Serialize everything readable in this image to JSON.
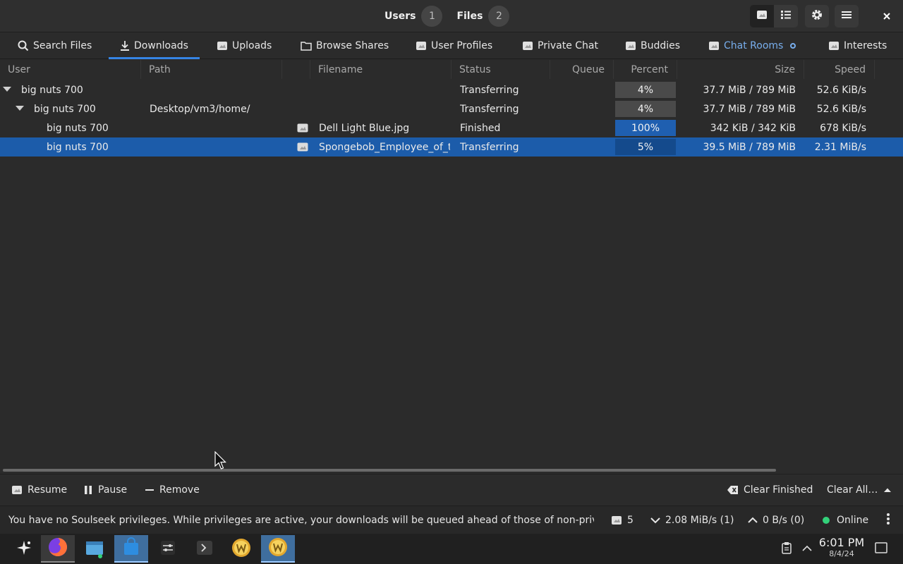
{
  "header": {
    "users_label": "Users",
    "users_count": "1",
    "files_label": "Files",
    "files_count": "2"
  },
  "tabs": [
    {
      "label": "Search Files",
      "icon": "search-icon"
    },
    {
      "label": "Downloads",
      "icon": "download-icon",
      "active": true
    },
    {
      "label": "Uploads",
      "icon": "missing-image-icon"
    },
    {
      "label": "Browse Shares",
      "icon": "folder-icon"
    },
    {
      "label": "User Profiles",
      "icon": "missing-image-icon"
    },
    {
      "label": "Private Chat",
      "icon": "missing-image-icon"
    },
    {
      "label": "Buddies",
      "icon": "missing-image-icon"
    },
    {
      "label": "Chat Rooms",
      "icon": "missing-image-icon",
      "highlight": true
    },
    {
      "label": "Interests",
      "icon": "missing-image-icon"
    }
  ],
  "columns": {
    "user": "User",
    "path": "Path",
    "filename": "Filename",
    "status": "Status",
    "queue": "Queue",
    "percent": "Percent",
    "size": "Size",
    "speed": "Speed"
  },
  "rows": [
    {
      "user": "big nuts 700",
      "path": "",
      "filename": "",
      "status": "Transferring",
      "queue": "",
      "percent": "4%",
      "size": "37.7 MiB / 789 MiB",
      "speed": "52.6 KiB/s"
    },
    {
      "user": "big nuts 700",
      "path": "Desktop/vm3/home/",
      "filename": "",
      "status": "Transferring",
      "queue": "",
      "percent": "4%",
      "size": "37.7 MiB / 789 MiB",
      "speed": "52.6 KiB/s"
    },
    {
      "user": "big nuts 700",
      "path": "",
      "filename": "Dell Light Blue.jpg",
      "status": "Finished",
      "queue": "",
      "percent": "100%",
      "size": "342 KiB / 342 KiB",
      "speed": "678 KiB/s"
    },
    {
      "user": "big nuts 700",
      "path": "",
      "filename": "Spongebob_Employee_of_the",
      "status": "Transferring",
      "queue": "",
      "percent": "5%",
      "size": "39.5 MiB / 789 MiB",
      "speed": "2.31 MiB/s",
      "selected": true
    }
  ],
  "actions": {
    "resume": "Resume",
    "pause": "Pause",
    "remove": "Remove",
    "clear_finished": "Clear Finished",
    "clear_all": "Clear All…"
  },
  "statusbar": {
    "message": "You have no Soulseek privileges. While privileges are active, your downloads will be queued ahead of those of non-privileged …",
    "connections": "5",
    "download_speed": "2.08 MiB/s (1)",
    "upload_speed": "0 B/s (0)",
    "status": "Online"
  },
  "taskbar": {
    "time": "6:01 PM",
    "date": "8/4/24"
  },
  "colors": {
    "accent": "#3584e4",
    "selected_row": "#1c5caa",
    "online": "#33d17a"
  }
}
